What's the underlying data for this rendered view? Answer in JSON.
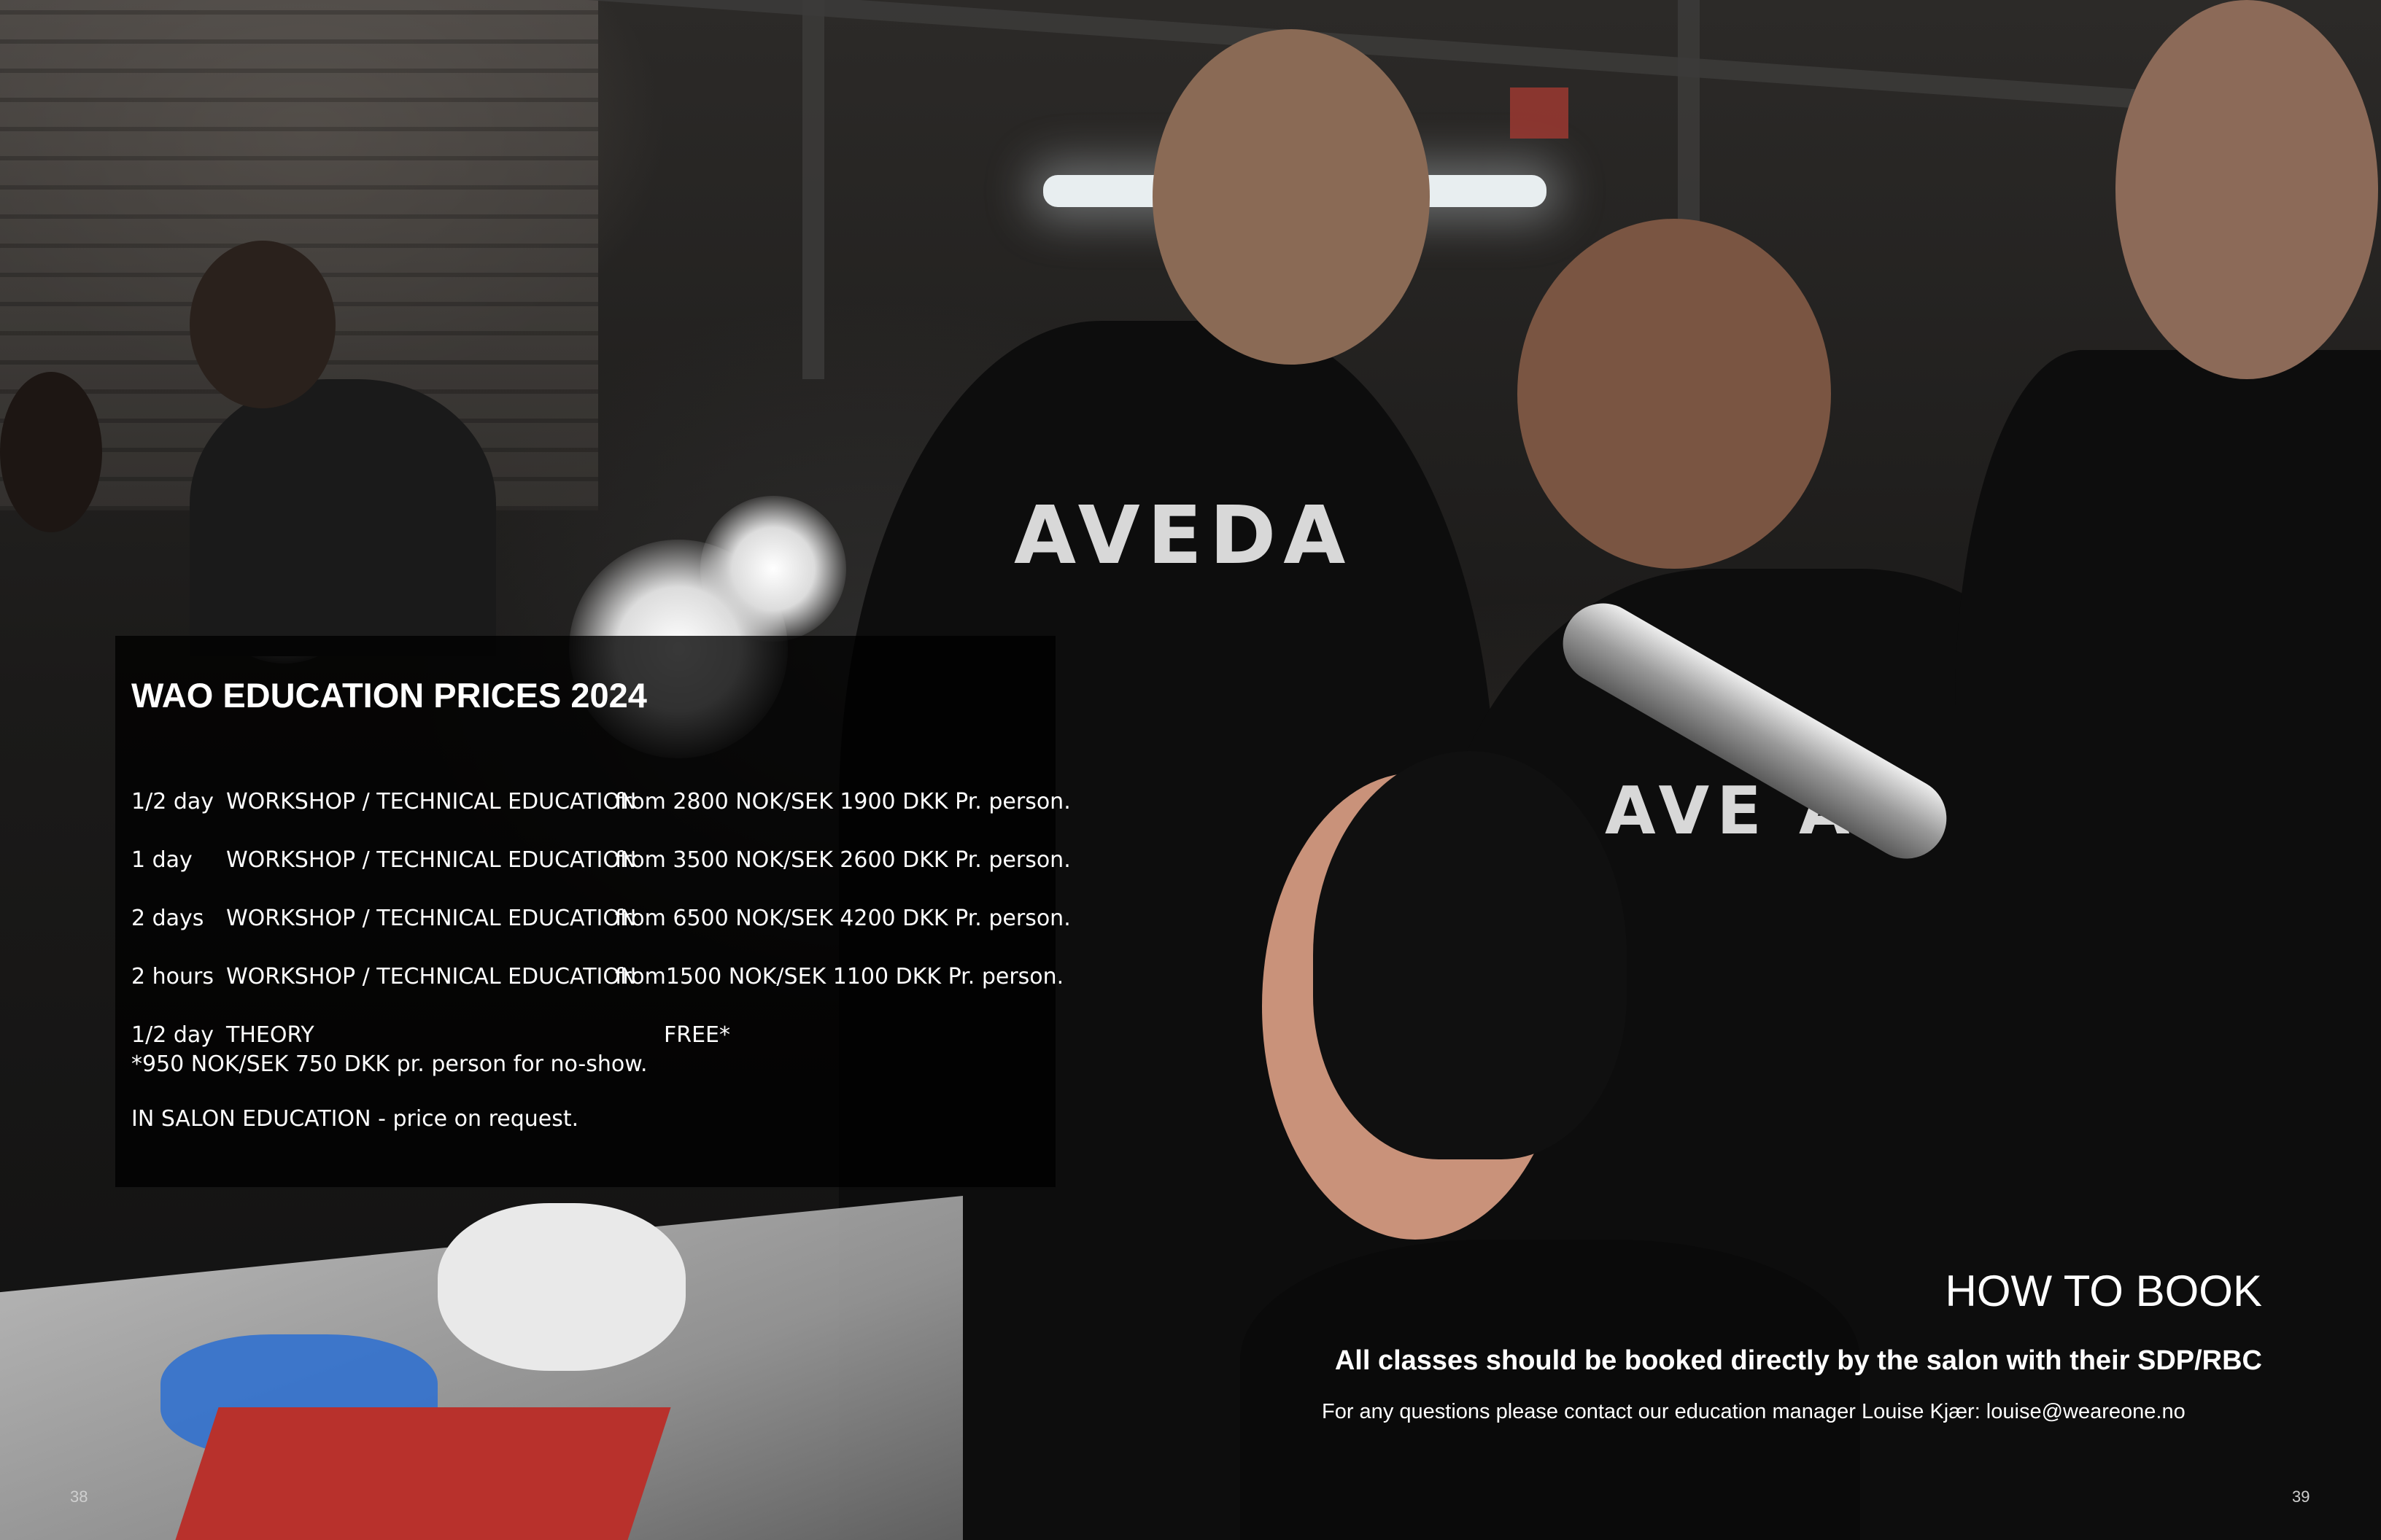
{
  "panel": {
    "title": "WAO EDUCATION PRICES 2024",
    "rows": [
      {
        "duration": "1/2 day",
        "course": "WORKSHOP / TECHNICAL EDUCATION",
        "price": "from 2800 NOK/SEK  1900 DKK Pr. person."
      },
      {
        "duration": "1 day",
        "course": "WORKSHOP / TECHNICAL EDUCATION",
        "price": "from 3500 NOK/SEK  2600 DKK Pr. person."
      },
      {
        "duration": "2 days",
        "course": "WORKSHOP / TECHNICAL EDUCATION",
        "price": "from 6500 NOK/SEK  4200 DKK Pr. person."
      },
      {
        "duration": "2 hours",
        "course": "WORKSHOP / TECHNICAL EDUCATION",
        "price": "from1500 NOK/SEK  1100 DKK Pr. person."
      }
    ],
    "theory": {
      "duration": "1/2 day",
      "course": "THEORY",
      "price": "FREE*"
    },
    "no_show_note": "*950 NOK/SEK  750 DKK pr. person for no-show.",
    "in_salon": "IN SALON EDUCATION - price on request."
  },
  "booking": {
    "title": "HOW TO BOOK",
    "lead": "All classes should be booked directly by the salon with their SDP/RBC",
    "contact": "For any questions  please contact our education manager Louise Kjær:  louise@weareone.no"
  },
  "photo": {
    "shirt_logo_1": "AVEDA",
    "shirt_logo_2": "AVE  A"
  },
  "pages": {
    "left": "38",
    "right": "39"
  }
}
